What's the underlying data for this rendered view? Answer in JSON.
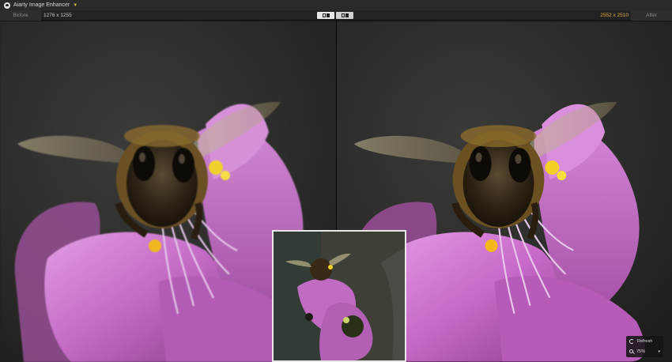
{
  "app": {
    "title": "Aiarty Image Enhancer",
    "icon": "app-logo-icon"
  },
  "toolbar": {
    "before_label": "Before",
    "before_size": "1276 x 1255",
    "after_size": "2552 x 2510",
    "after_label": "After",
    "view_modes": [
      "split-view-icon",
      "side-by-side-icon"
    ]
  },
  "zoom": {
    "refresh_label": "Refresh",
    "zoom_value": "75%"
  },
  "colors": {
    "accent": "#e0a830",
    "flower": "#c767c9",
    "bee": "#3a2a1a"
  }
}
